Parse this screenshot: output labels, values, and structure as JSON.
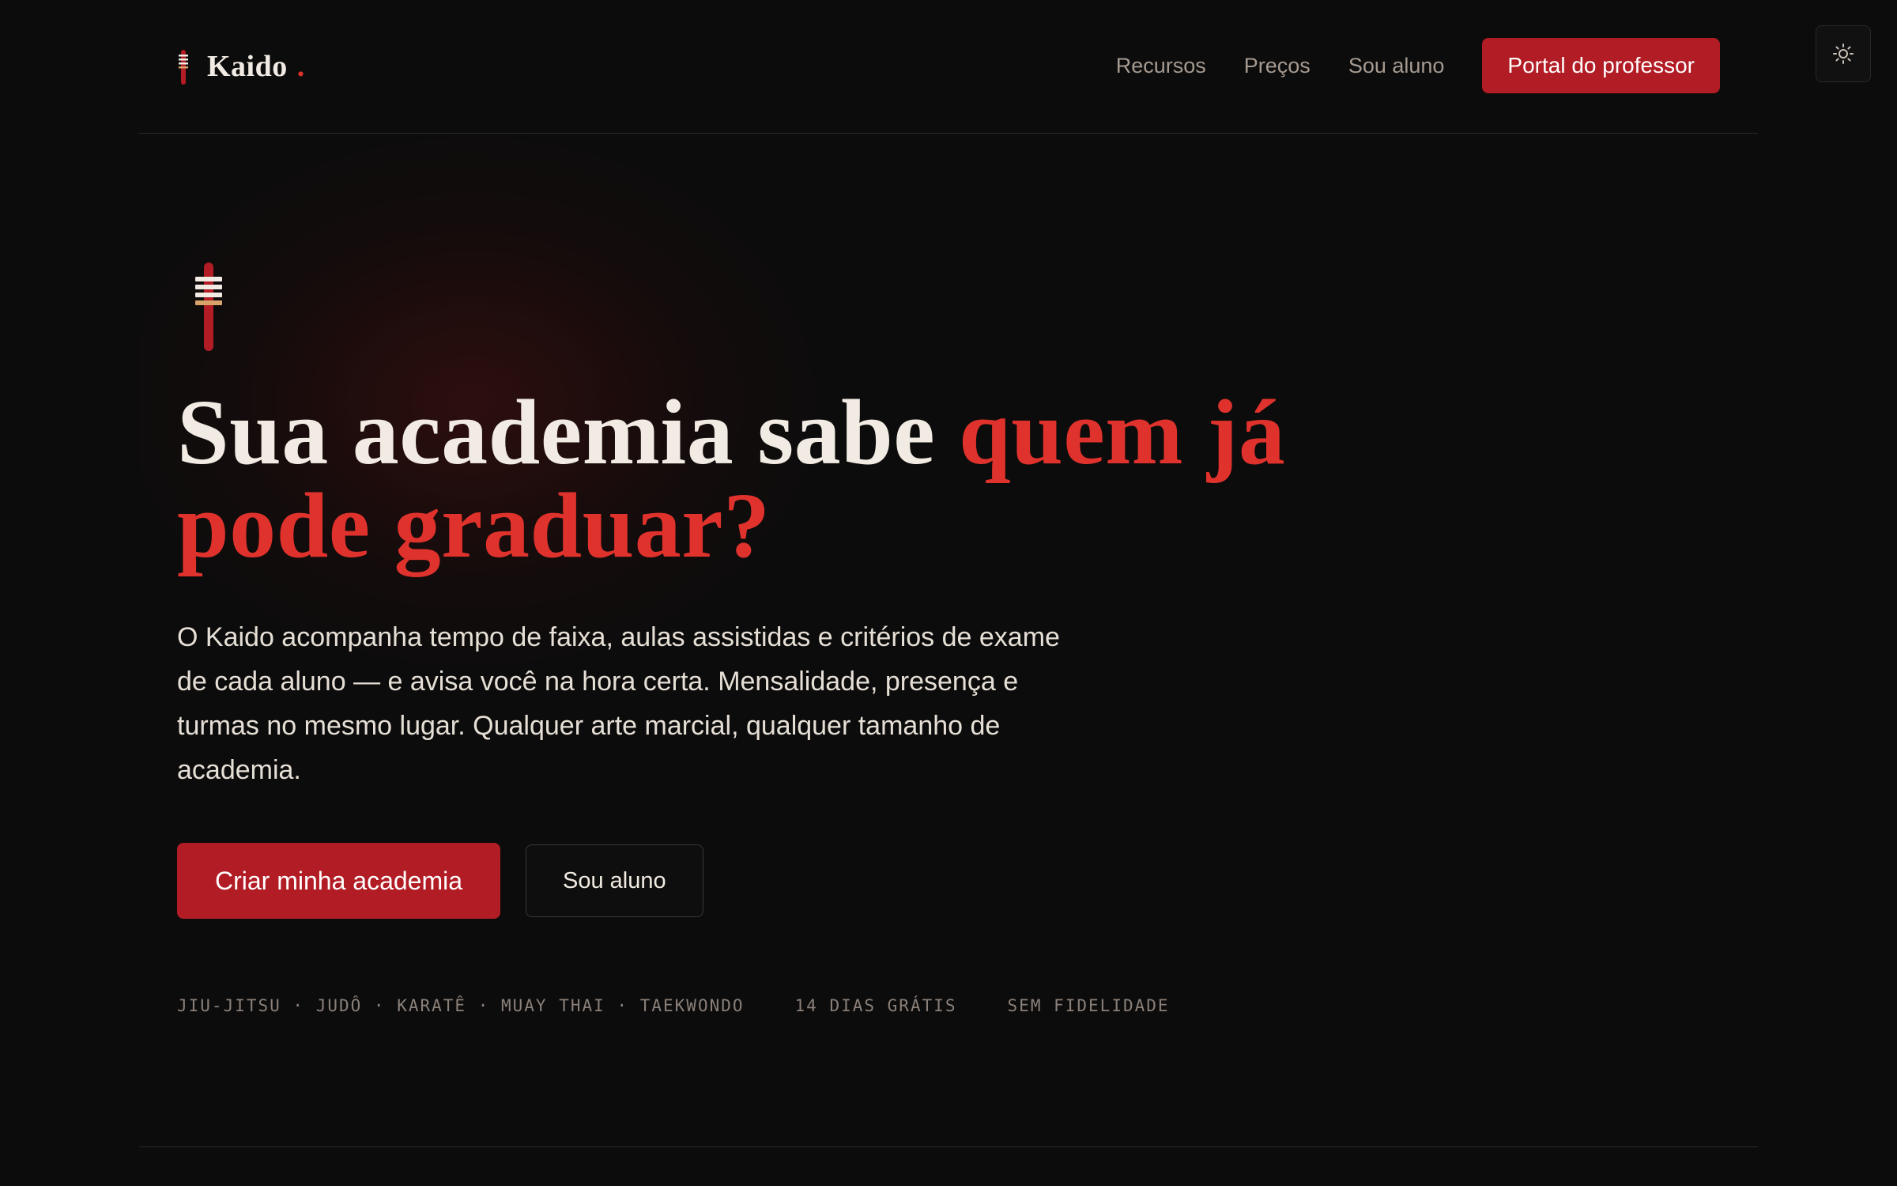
{
  "header": {
    "brand": "Kaido",
    "brand_dot": ".",
    "nav": [
      {
        "label": "Recursos"
      },
      {
        "label": "Preços"
      },
      {
        "label": "Sou aluno"
      }
    ],
    "cta_label": "Portal do professor",
    "theme_icon": "sun-icon"
  },
  "hero": {
    "headline_part1": "Sua academia sabe ",
    "headline_accent": "quem já pode graduar?",
    "lead": "O Kaido acompanha tempo de faixa, aulas assistidas e critérios de exame de cada aluno — e avisa você na hora certa. Mensalidade, presença e turmas no mesmo lugar. Qualquer arte marcial, qualquer tamanho de academia.",
    "primary_cta": "Criar minha academia",
    "secondary_cta": "Sou aluno",
    "tags": [
      "JIU-JITSU · JUDÔ · KARATÊ · MUAY THAI · TAEKWONDO",
      "14 DIAS GRÁTIS",
      "SEM FIDELIDADE"
    ]
  },
  "colors": {
    "background": "#0d0c0c",
    "accent": "#e0322c",
    "button": "#b21c24",
    "text": "#f1ebe3",
    "muted": "#a59a90"
  }
}
